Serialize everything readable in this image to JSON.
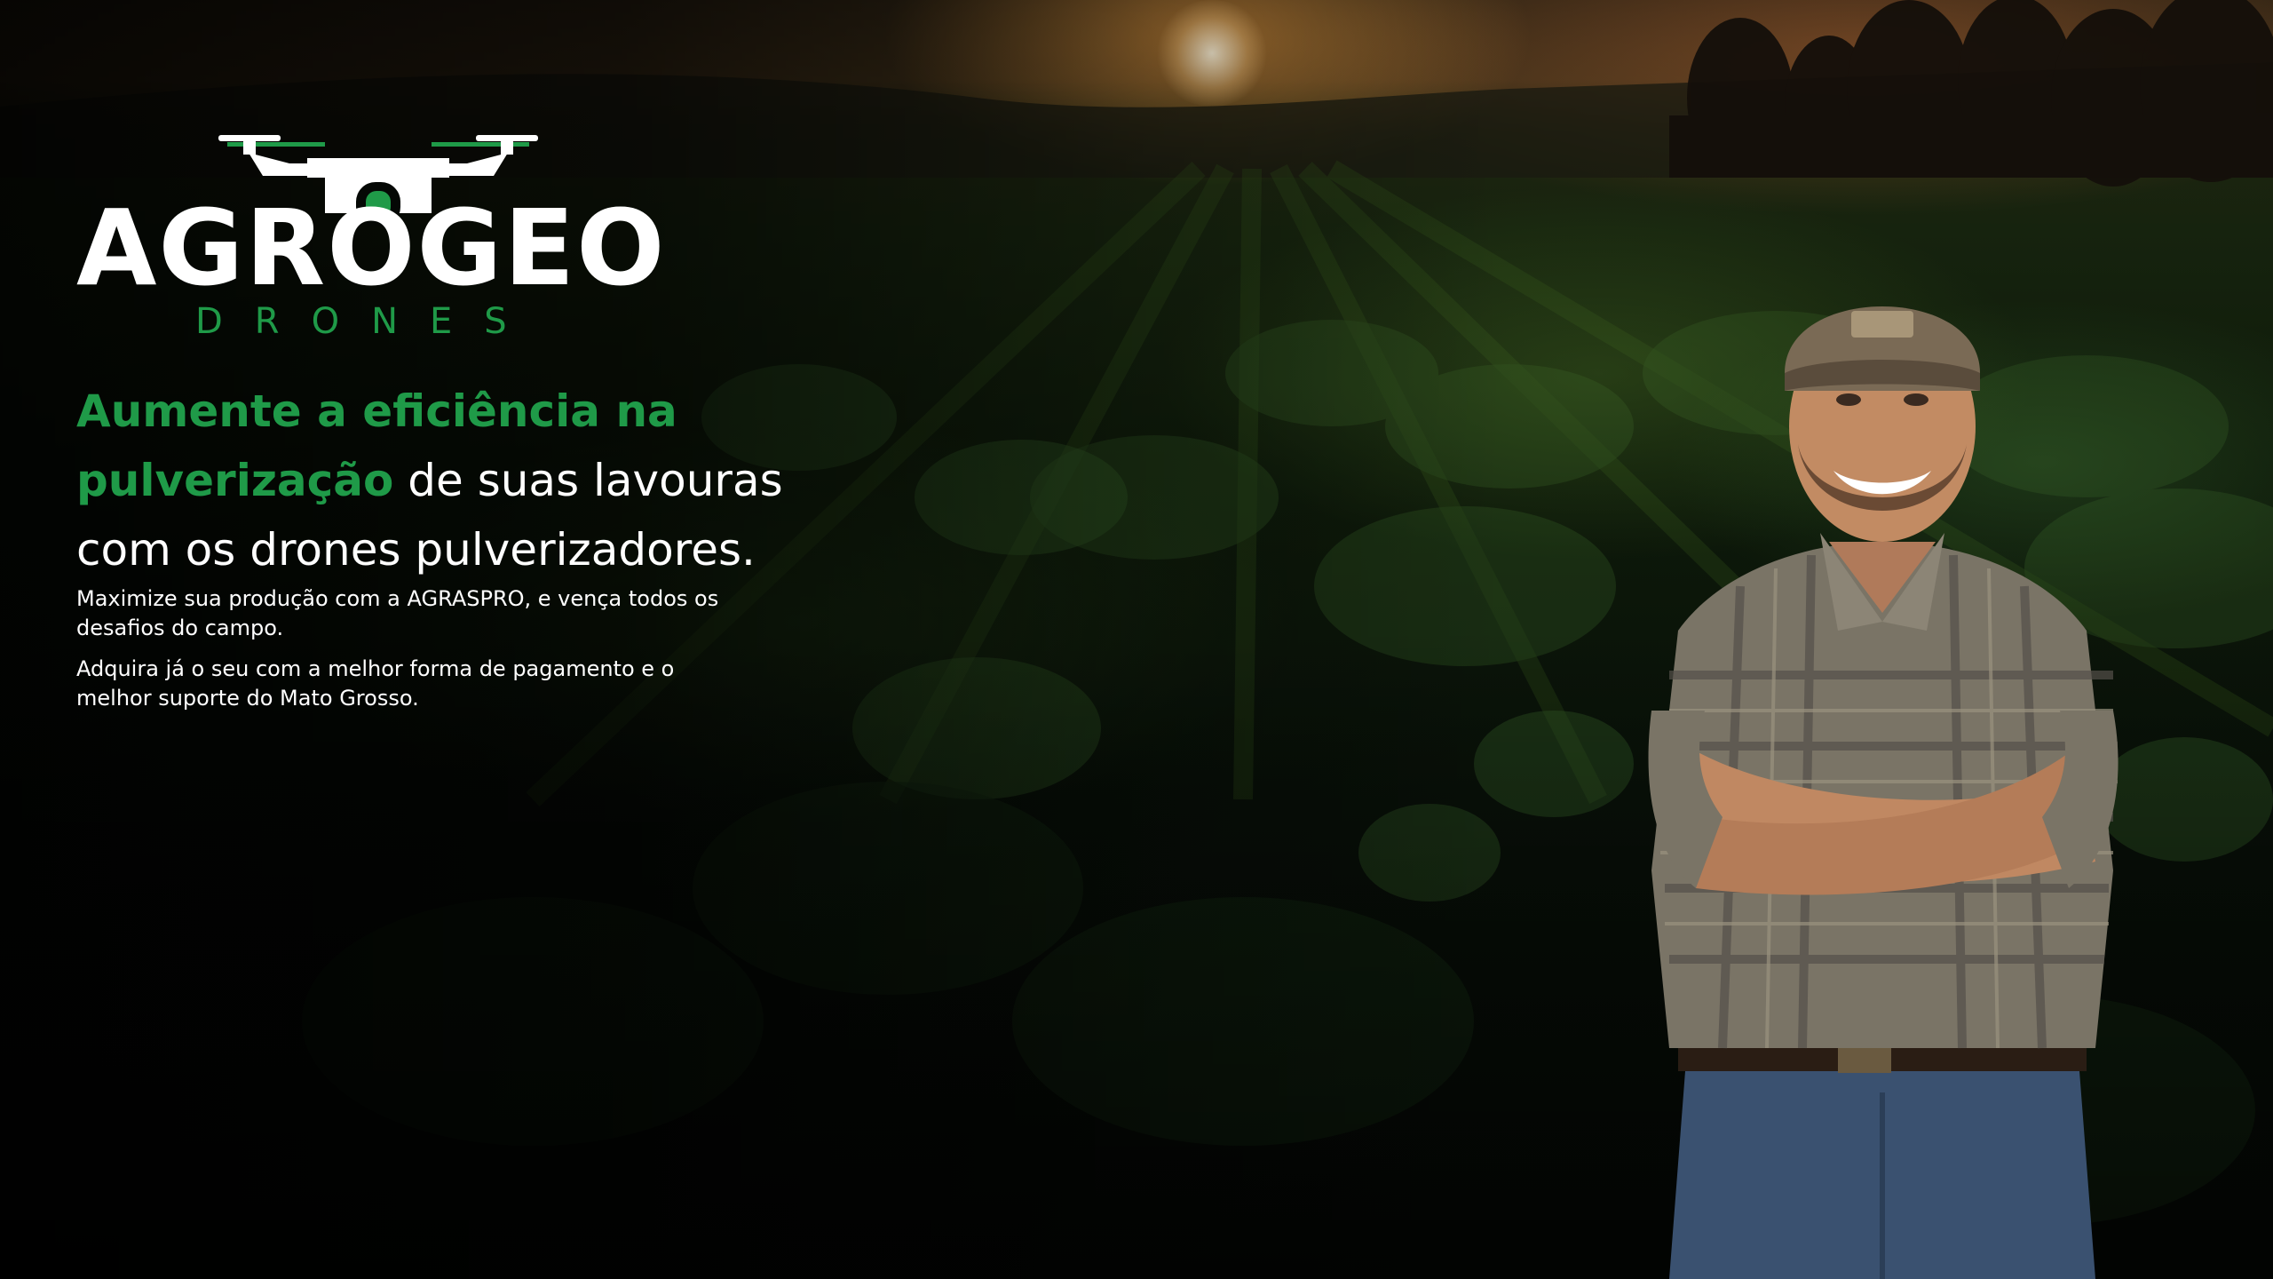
{
  "brand": {
    "name": "AGROGEO",
    "subtitle": "DRONES",
    "accent_color": "#1f9a48"
  },
  "hero": {
    "headline_accent": "Aumente a eficiência na pulverização",
    "headline_rest": " de suas lavouras com os drones pulverizadores.",
    "paragraph_1": "Maximize sua produção com a AGRASPRO, e vença todos os desafios do campo.",
    "paragraph_2": "Adquira já o seu com a melhor forma de pagamento e o melhor suporte do Mato Grosso."
  },
  "icons": {
    "logo_drone": "drone-icon"
  }
}
